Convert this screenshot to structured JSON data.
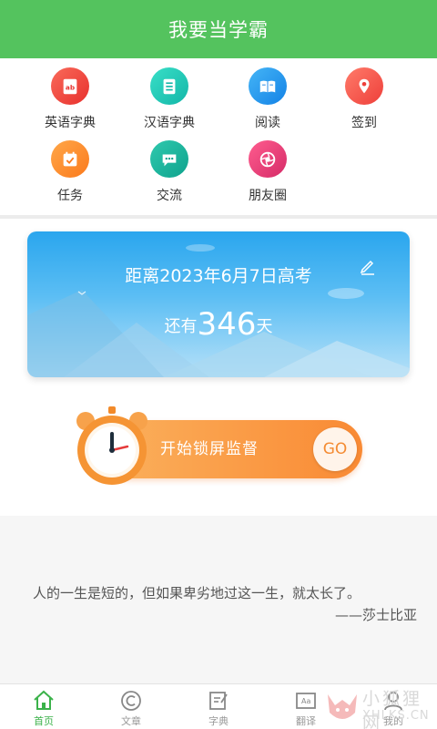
{
  "header": {
    "title": "我要当学霸"
  },
  "features": [
    {
      "label": "英语字典",
      "icon": "english-dictionary-icon",
      "color": "#f0433a"
    },
    {
      "label": "汉语字典",
      "icon": "chinese-dictionary-icon",
      "color": "#21c8b4"
    },
    {
      "label": "阅读",
      "icon": "book-icon",
      "color": "#1e9cf0"
    },
    {
      "label": "签到",
      "icon": "location-pin-icon",
      "color": "#f65b4d"
    },
    {
      "label": "任务",
      "icon": "calendar-check-icon",
      "color": "#fd8b2c"
    },
    {
      "label": "交流",
      "icon": "chat-bubble-icon",
      "color": "#15b39a"
    },
    {
      "label": "朋友圈",
      "icon": "shutter-icon",
      "color": "#e83a78"
    }
  ],
  "countdown": {
    "title": "距离2023年6月7日高考",
    "prefix": "还有",
    "days": "346",
    "suffix": "天"
  },
  "lock": {
    "label": "开始锁屏监督",
    "go": "GO"
  },
  "quote": {
    "text": "人的一生是短的，但如果卑劣地过这一生，就太长了。",
    "author": "——莎士比亚"
  },
  "tabs": [
    {
      "label": "首页",
      "icon": "home-icon"
    },
    {
      "label": "文章",
      "icon": "copyright-icon"
    },
    {
      "label": "字典",
      "icon": "dictionary-edit-icon"
    },
    {
      "label": "翻译",
      "icon": "translate-icon"
    },
    {
      "label": "我的",
      "icon": "user-icon"
    }
  ],
  "watermark": {
    "title": "小狐狸网",
    "domain": "XHLKS.CN"
  },
  "colors": {
    "header": "#54c35e",
    "active_tab": "#3bb24a",
    "button": "#f98a34"
  }
}
